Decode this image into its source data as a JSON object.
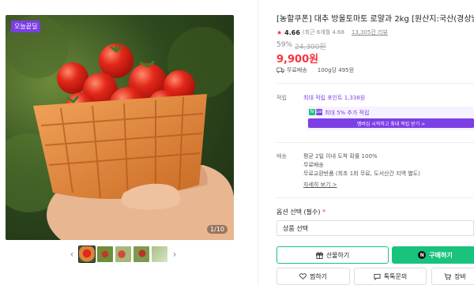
{
  "gallery": {
    "badge": "오늘끝딜",
    "counter": "1/10",
    "prev_arrow": "‹",
    "next_arrow": "›"
  },
  "product": {
    "title": "[농할쿠폰] 대추 방울토마토 로얄과 2kg [원산지:국산(경상남",
    "star": "★",
    "rating": "4.66",
    "rating_note": "(최근 6개월 4.68",
    "review_count": "13,305건 리뷰",
    "discount_rate": "59%",
    "original_price": "24,300원",
    "price": "9,900원",
    "shipping_label": "무료배송",
    "shipping_sub": "100g당 495원"
  },
  "points": {
    "label": "적립",
    "max_point": "최대 적립 포인트 1,338원",
    "n_badge": "N",
    "pay_badge": "pay",
    "extra_point": "최대 5% 추가 적립",
    "join_button": "멤버십 시작하고 최대 적립 받기 >"
  },
  "delivery": {
    "label": "배송",
    "line1": "평균 2일 이내 도착 확률 100%",
    "line2": "무료배송",
    "line3": "무료교환반품 (최초 1회 무료, 도서산간 지역 별도)",
    "detail_link": "자세히 보기 >"
  },
  "options": {
    "label": "옵션 선택 (필수)",
    "required_mark": "*",
    "select_placeholder": "상품 선택"
  },
  "actions": {
    "gift": "선물하기",
    "buy": "구매하기",
    "buy_badge": "N",
    "wish": "찜하기",
    "talk": "톡톡문의",
    "cart": "장바"
  },
  "colors": {
    "accent_green": "#19c37d",
    "accent_purple": "#7b3fe4",
    "price_red": "#f5333f"
  }
}
